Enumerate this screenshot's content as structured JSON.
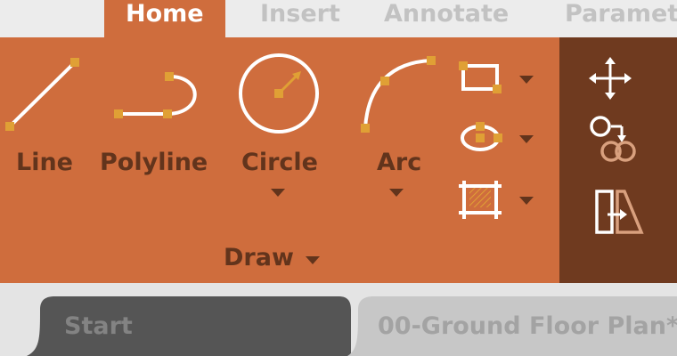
{
  "tabs": {
    "home": "Home",
    "insert": "Insert",
    "annotate": "Annotate",
    "parametric": "Paramet"
  },
  "draw_panel": {
    "line": "Line",
    "polyline": "Polyline",
    "circle": "Circle",
    "arc": "Arc",
    "panel_title": "Draw"
  },
  "document_tabs": {
    "start": "Start",
    "current": "00-Ground Floor Plan*"
  },
  "colors": {
    "ribbon": "#cf6d3d",
    "modify_panel": "#6f3a1f",
    "grip": "#e0a035",
    "label": "#62341c"
  },
  "icons": [
    "line-icon",
    "polyline-icon",
    "circle-icon",
    "arc-icon",
    "rectangle-icon",
    "ellipse-icon",
    "hatch-icon",
    "move-icon",
    "copy-icon",
    "mirror-icon"
  ]
}
